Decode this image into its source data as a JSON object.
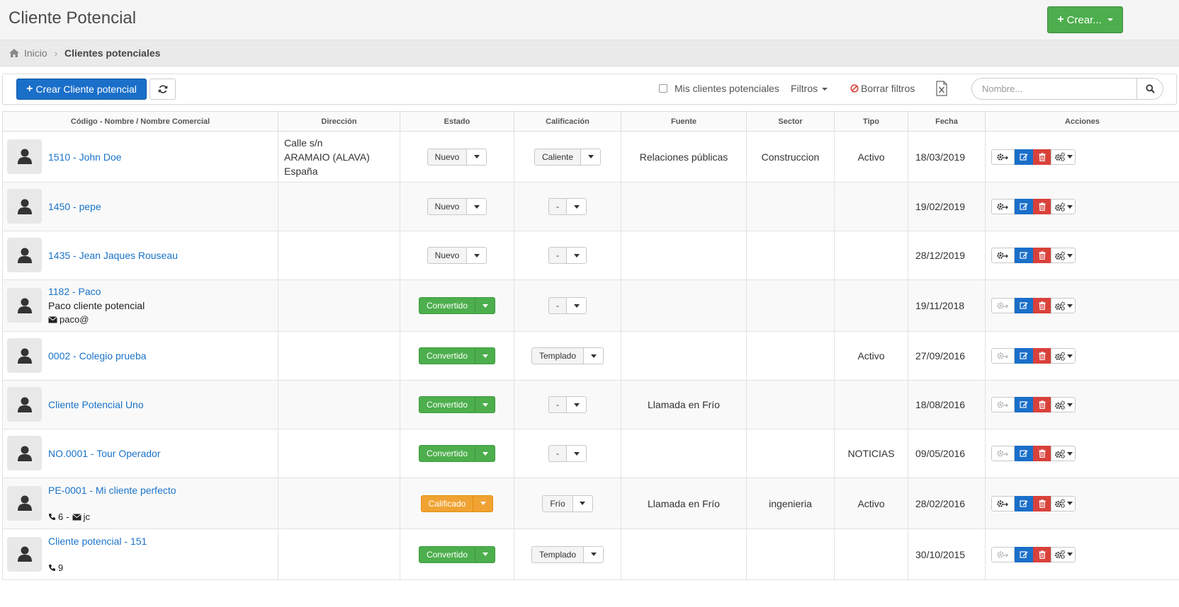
{
  "header": {
    "title": "Cliente Potencial",
    "create_label": "Crear..."
  },
  "breadcrumb": {
    "home": "Inicio",
    "current": "Clientes potenciales"
  },
  "toolbar": {
    "create_label": "Crear Cliente potencial",
    "mine_label": "Mis clientes potenciales",
    "filters_label": "Filtros",
    "clear_filters_label": "Borrar filtros",
    "search_placeholder": "Nombre..."
  },
  "columns": [
    "Código - Nombre / Nombre Comercial",
    "Dirección",
    "Estado",
    "Calificación",
    "Fuente",
    "Sector",
    "Tipo",
    "Fecha",
    "Acciones"
  ],
  "colors": {
    "primary": "#1a6fc9",
    "success": "#4cae4c",
    "warning": "#f0a332",
    "danger": "#d9413b",
    "link": "#1a73c9"
  },
  "rows": [
    {
      "name": "1510 - John Doe",
      "extra": "",
      "phone": "",
      "email": "",
      "addr1": "Calle s/n",
      "addr2": "ARAMAIO (ALAVA)",
      "addr3": "España",
      "status": "Nuevo",
      "status_style": "default",
      "rating": "Caliente",
      "source": "Relaciones públicas",
      "sector": "Construccion",
      "type": "Activo",
      "date": "18/03/2019",
      "convert_enabled": true
    },
    {
      "name": "1450 - pepe",
      "extra": "",
      "phone": "",
      "email": "",
      "addr1": "",
      "addr2": "",
      "addr3": "",
      "status": "Nuevo",
      "status_style": "default",
      "rating": "-",
      "source": "",
      "sector": "",
      "type": "",
      "date": "19/02/2019",
      "convert_enabled": true
    },
    {
      "name": "1435 - Jean Jaques Rouseau",
      "extra": "",
      "phone": "",
      "email": "",
      "addr1": "",
      "addr2": "",
      "addr3": "",
      "status": "Nuevo",
      "status_style": "default",
      "rating": "-",
      "source": "",
      "sector": "",
      "type": "",
      "date": "28/12/2019",
      "convert_enabled": true
    },
    {
      "name": "1182 - Paco",
      "extra": "Paco cliente potencial",
      "phone": "",
      "email": "paco@",
      "addr1": "",
      "addr2": "",
      "addr3": "",
      "status": "Convertido",
      "status_style": "success",
      "rating": "-",
      "source": "",
      "sector": "",
      "type": "",
      "date": "19/11/2018",
      "convert_enabled": false
    },
    {
      "name": "0002 - Colegio prueba",
      "extra": "",
      "phone": "",
      "email": "",
      "addr1": "",
      "addr2": "",
      "addr3": "",
      "status": "Convertido",
      "status_style": "success",
      "rating": "Templado",
      "source": "",
      "sector": "",
      "type": "Activo",
      "date": "27/09/2016",
      "convert_enabled": false
    },
    {
      "name": "Cliente Potencial Uno",
      "extra": "",
      "phone": "",
      "email": "",
      "addr1": "",
      "addr2": "",
      "addr3": "",
      "status": "Convertido",
      "status_style": "success",
      "rating": "-",
      "source": "Llamada en Frío",
      "sector": "",
      "type": "",
      "date": "18/08/2016",
      "convert_enabled": false
    },
    {
      "name": "NO.0001 - Tour Operador",
      "extra": "",
      "phone": "",
      "email": "",
      "addr1": "",
      "addr2": "",
      "addr3": "",
      "status": "Convertido",
      "status_style": "success",
      "rating": "-",
      "source": "",
      "sector": "",
      "type": "NOTICIAS",
      "date": "09/05/2016",
      "convert_enabled": false
    },
    {
      "name": "PE-0001 - Mi cliente perfecto",
      "extra": "",
      "phone": "6",
      "email": "jc",
      "addr1": "",
      "addr2": "",
      "addr3": "",
      "status": "Calificado",
      "status_style": "warning",
      "rating": "Frío",
      "source": "Llamada en Frío",
      "sector": "ingenieria",
      "type": "Activo",
      "date": "28/02/2016",
      "convert_enabled": true
    },
    {
      "name": "Cliente potencial - 151",
      "extra": "",
      "phone": "9",
      "email": "",
      "addr1": "",
      "addr2": "",
      "addr3": "",
      "status": "Convertido",
      "status_style": "success",
      "rating": "Templado",
      "source": "",
      "sector": "",
      "type": "",
      "date": "30/10/2015",
      "convert_enabled": false
    }
  ]
}
